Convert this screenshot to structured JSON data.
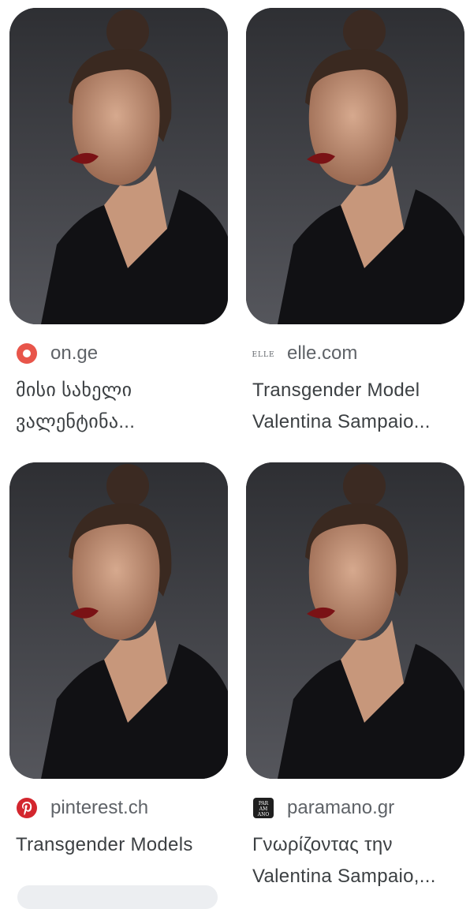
{
  "results": [
    {
      "source": "on.ge",
      "favicon": "on-ge-icon",
      "title_lines": [
        "მისი სახელი",
        "ვალენტინა..."
      ]
    },
    {
      "source": "elle.com",
      "favicon": "elle-icon",
      "favicon_text": "ELLE",
      "title_lines": [
        "Transgender Model",
        "Valentina Sampaio..."
      ]
    },
    {
      "source": "pinterest.ch",
      "favicon": "pinterest-icon",
      "title_lines": [
        "Transgender Models"
      ]
    },
    {
      "source": "paramano.gr",
      "favicon": "paramano-icon",
      "favicon_text": "PAR AM ANO",
      "title_lines": [
        "Γνωρίζοντας την",
        "Valentina Sampaio,..."
      ]
    }
  ],
  "colors": {
    "on_ge": "#e8554a",
    "pinterest": "#d3262e",
    "source_text": "#5f6368",
    "title_text": "#3c4043"
  }
}
